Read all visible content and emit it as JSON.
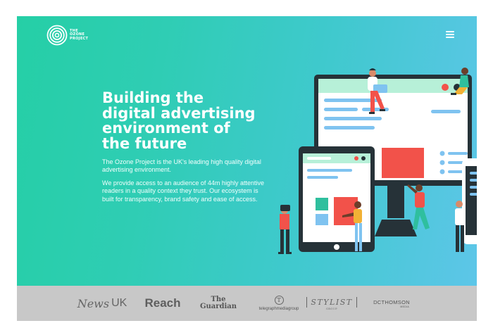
{
  "header": {
    "logo_lines": [
      "THE",
      "OZONE",
      "PROJECT"
    ],
    "menu_icon": "hamburger-menu-icon"
  },
  "hero": {
    "headline_lines": [
      "Building the",
      "digital advertising",
      "environment of",
      "the future"
    ],
    "intro": "The Ozone Project is the UK's leading high quality digital advertising environment.",
    "body": "We provide access to an audience of 44m highly attentive readers in a quality context they trust. Our ecosystem is built for transparency, brand safety and ease of access.",
    "illustration_icon": "devices-and-people-illustration"
  },
  "publishers": {
    "news_uk": {
      "word": "News",
      "suffix": "UK"
    },
    "reach": "Reach",
    "guardian": [
      "The",
      "Guardian"
    ],
    "telegraph": {
      "mark": "T",
      "name": "telegraphmediagroup"
    },
    "stylist": {
      "name": "STYLIST",
      "sub": "GROUP"
    },
    "dc_thomson": {
      "name": "DCTHOMSON",
      "sub": "MEDIA"
    }
  },
  "colors": {
    "gradient_start": "#25cfa6",
    "gradient_end": "#5dc6e8",
    "accent_red": "#f2524a",
    "dark_device": "#263238",
    "logo_strip": "#c8c8c8"
  }
}
